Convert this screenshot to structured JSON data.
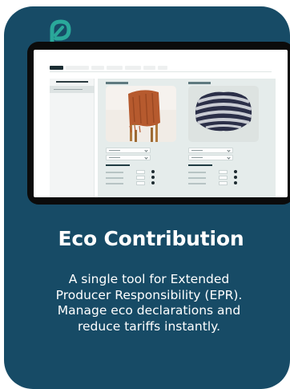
{
  "brand": {
    "logo_icon": "leaf-shield-logo-icon",
    "accent_color": "#2aa89a",
    "card_color": "#174b66"
  },
  "card": {
    "title": "Eco Contribution",
    "description_lines": [
      "A single tool for Extended",
      "Producer Responsibility (EPR).",
      "Manage eco declarations and",
      "reduce tariffs instantly."
    ]
  },
  "screenshot": {
    "products": [
      {
        "image_icon": "wooden-chair-with-knit-blanket-image"
      },
      {
        "image_icon": "striped-knit-sweater-image"
      }
    ]
  }
}
